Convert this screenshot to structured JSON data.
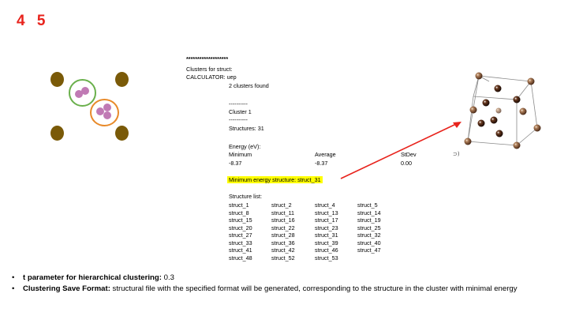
{
  "slide_numbers": [
    "4",
    "5"
  ],
  "console": {
    "stars": "*******************",
    "header": "Clusters for struct:",
    "calculator": "CALCULATOR: uep",
    "found": "2 clusters found",
    "dash1": "----------",
    "cluster": "Cluster 1",
    "dash2": "----------",
    "structures": "Structures: 31",
    "energy_label": "Energy (eV):",
    "col_min": "Minimum",
    "col_avg": "Average",
    "col_std": "StDev",
    "val_min": "-8.37",
    "val_avg": "-8.37",
    "val_std": "0.00",
    "min_struct": "Minimum energy structure: struct_31",
    "list_label": "Structure list:",
    "list": [
      [
        "struct_1",
        "struct_2",
        "struct_4",
        "struct_5"
      ],
      [
        "struct_8",
        "struct_11",
        "struct_13",
        "struct_14"
      ],
      [
        "struct_15",
        "struct_16",
        "struct_17",
        "struct_19"
      ],
      [
        "struct_20",
        "struct_22",
        "struct_23",
        "struct_25"
      ],
      [
        "struct_27",
        "struct_28",
        "struct_31",
        "struct_32"
      ],
      [
        "struct_33",
        "struct_36",
        "struct_39",
        "struct_40"
      ],
      [
        "struct_41",
        "struct_42",
        "struct_46",
        "struct_47"
      ],
      [
        "struct_48",
        "struct_52",
        "struct_53",
        ""
      ]
    ]
  },
  "bullets": [
    {
      "bold": "t parameter for hierarchical clustering:",
      "text": " 0.3"
    },
    {
      "bold": "Clustering Save Format:",
      "text": " structural file with the specified format will be generated, corresponding to the structure in the cluster with minimal energy"
    }
  ],
  "colors": {
    "accent_red": "#e8231c",
    "highlight": "#ffff00",
    "green_ring": "#6ab04c",
    "orange_ring": "#e88a2a"
  },
  "icons": [
    "cluster-diagram",
    "crystal-structure",
    "arrow"
  ]
}
